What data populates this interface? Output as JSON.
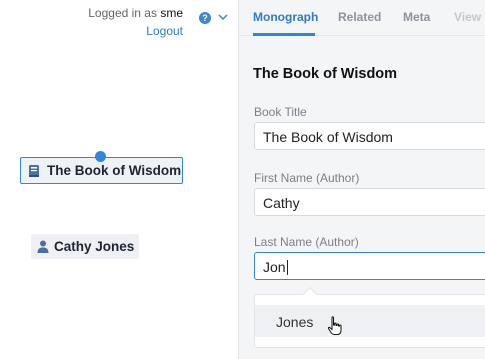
{
  "header": {
    "logged_in_prefix": "Logged in as",
    "username": "sme",
    "logout_label": "Logout",
    "help_icon": "question-circle-icon",
    "menu_icon": "chevron-down-icon"
  },
  "canvas": {
    "book_node": {
      "icon": "book-icon",
      "label": "The Book of Wisdom"
    },
    "person_node": {
      "icon": "person-icon",
      "label": "Cathy Jones"
    }
  },
  "panel": {
    "tabs": [
      {
        "label": "Monograph",
        "active": true
      },
      {
        "label": "Related",
        "active": false
      },
      {
        "label": "Meta",
        "active": false
      },
      {
        "label": "View",
        "active": false
      }
    ],
    "title": "The Book of Wisdom",
    "fields": [
      {
        "label": "Book Title",
        "value": "The Book of Wisdom"
      },
      {
        "label": "First Name (Author)",
        "value": "Cathy"
      },
      {
        "label": "Last Name (Author)",
        "value": "Jon"
      }
    ],
    "autocomplete": {
      "options": [
        "Jones"
      ]
    }
  },
  "colors": {
    "accent": "#2f86e0",
    "link": "#2f7cc7",
    "panel_bg": "#f4f5f7"
  }
}
